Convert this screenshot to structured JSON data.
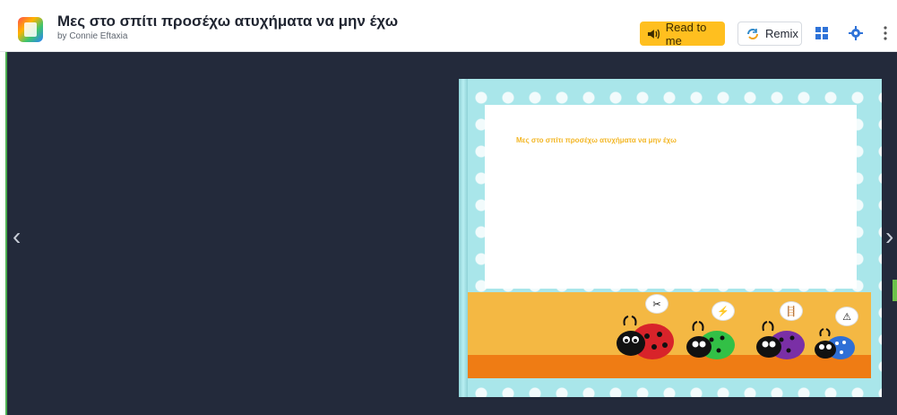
{
  "header": {
    "title": "Μες στο σπίτι προσέχω ατυχήματα να μην έχω",
    "author": "by Connie Eftaxia",
    "read_label": "Read to me",
    "remix_label": "Remix"
  },
  "book": {
    "cover_title": "Μες στο σπίτι προσέχω ατυχήματα να μην έχω"
  },
  "colors": {
    "read_button": "#ffbf1f",
    "background": "#232a3b",
    "book_border": "#a9e6ea"
  }
}
